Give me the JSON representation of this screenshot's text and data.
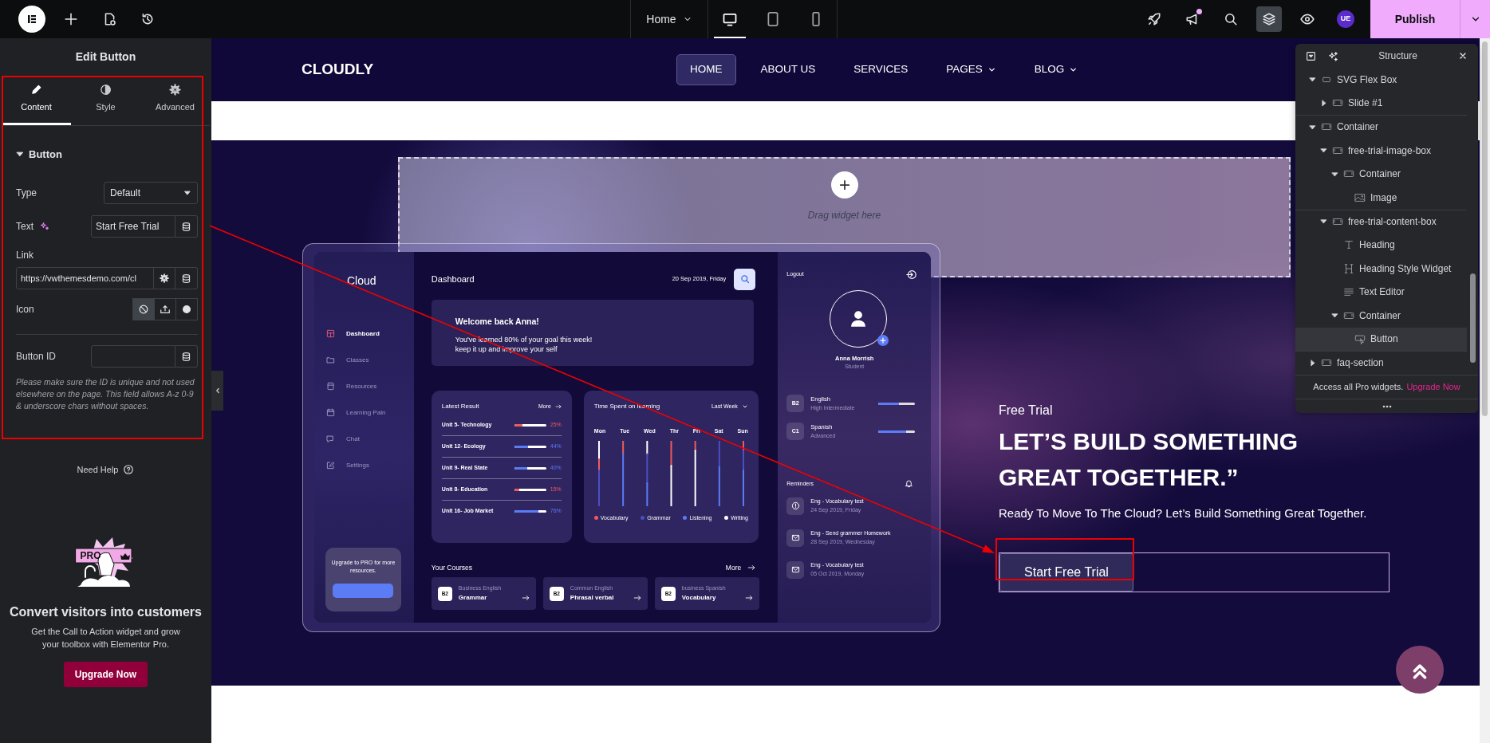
{
  "topbar": {
    "page": "Home",
    "devices": [
      {
        "kind": "desktop",
        "selected": true
      },
      {
        "kind": "tablet",
        "selected": false
      },
      {
        "kind": "mobile",
        "selected": false
      }
    ],
    "notification": true,
    "structure_open": true,
    "avatar": "UE",
    "publish": "Publish"
  },
  "editor_panel": {
    "title": "Edit Button",
    "tabs": [
      {
        "label": "Content",
        "kind": "pencil",
        "selected": true
      },
      {
        "label": "Style",
        "kind": "contrast",
        "selected": false
      },
      {
        "label": "Advanced",
        "kind": "gear",
        "selected": false
      }
    ],
    "section": {
      "title": "Button",
      "expanded": true
    },
    "fields": [
      {
        "kind": "select",
        "label": "Type",
        "value": "Default"
      },
      {
        "kind": "text",
        "label": "Text",
        "value": "Start Free Trial",
        "ai": true
      },
      {
        "kind": "link",
        "label": "Link",
        "value": "https://vwthemesdemo.com/cl"
      },
      {
        "kind": "choice",
        "label": "Icon",
        "options": [
          {
            "kind": "none",
            "selected": true
          },
          {
            "kind": "upload",
            "selected": false
          },
          {
            "kind": "svg",
            "selected": false
          }
        ]
      },
      {
        "kind": "id",
        "label": "Button ID"
      }
    ],
    "note": "Please make sure the ID is unique and not used elsewhere on the page. This field allows A-z  0-9 & underscore chars without spaces."
  },
  "help": "Need Help",
  "promo": {
    "badge": "PRO",
    "title": "Convert visitors into customers",
    "text": "Get the Call to Action widget and grow your toolbox with Elementor Pro.",
    "button": "Upgrade Now"
  },
  "site": {
    "brand": "CLOUDLY",
    "nav": [
      {
        "label": "HOME",
        "selected": true,
        "dropdown": false
      },
      {
        "label": "ABOUT US",
        "selected": false,
        "dropdown": false
      },
      {
        "label": "SERVICES",
        "selected": false,
        "dropdown": false
      },
      {
        "label": "PAGES",
        "selected": false,
        "dropdown": true
      },
      {
        "label": "BLOG",
        "selected": false,
        "dropdown": true
      }
    ],
    "dropzone": "Drag widget here",
    "dashboard": {
      "brand": "Cloud",
      "title": "Dashboard",
      "date": "20 Sep 2019, Friday",
      "menu": [
        {
          "label": "Dashboard",
          "kind": "grid",
          "selected": true
        },
        {
          "label": "Classes",
          "kind": "folder",
          "selected": false
        },
        {
          "label": "Resources",
          "kind": "box",
          "selected": false
        },
        {
          "label": "Learning Paln",
          "kind": "calendar",
          "selected": false
        },
        {
          "label": "Chat",
          "kind": "chat",
          "selected": false
        },
        {
          "label": "Settings",
          "kind": "edit",
          "selected": false
        }
      ],
      "upgrade": "Upgrade to PRO for more resources.",
      "welcome": {
        "title": "Welcome back Anna!",
        "lines": [
          "You've learned 80% of your goal this week!",
          "keep it up and improve your self"
        ]
      },
      "results": {
        "title": "Latest Result",
        "more": "More",
        "rows": [
          {
            "name": "Unit 5- Technology",
            "level": 0.25,
            "reading": "25%",
            "color": "#ef5b5b"
          },
          {
            "name": "Unit 12- Ecology",
            "level": 0.44,
            "reading": "44%",
            "color": "#5b7cf5"
          },
          {
            "name": "Unit 9- Real State",
            "level": 0.4,
            "reading": "40%",
            "color": "#5b7cf5"
          },
          {
            "name": "Unit 8- Education",
            "level": 0.15,
            "reading": "15%",
            "color": "#ef5b5b"
          },
          {
            "name": "Unit 16- Job Market",
            "level": 0.76,
            "reading": "76%",
            "color": "#5b7cf5"
          }
        ]
      },
      "time": {
        "title": "Time Spent on learning",
        "period": "Last Week",
        "days": [
          "Mon",
          "Tue",
          "Wed",
          "Thr",
          "Fri",
          "Sat",
          "Sun"
        ],
        "legend": [
          {
            "label": "Vocabulary",
            "color": "#ef5b5b"
          },
          {
            "label": "Grammar",
            "color": "#4b4fc0"
          },
          {
            "label": "Listening",
            "color": "#5b7cf5"
          },
          {
            "label": "Writing",
            "color": "#ffffff"
          }
        ]
      },
      "courses": {
        "title": "Your Courses",
        "more": "More",
        "items": [
          {
            "grade": "B2",
            "category": "Business English",
            "name": "Grammar"
          },
          {
            "grade": "B2",
            "category": "Common English",
            "name": "Phrasal verbal"
          },
          {
            "grade": "B2",
            "category": "business Spanish",
            "name": "Vocabulary"
          }
        ]
      },
      "logout": "Logout",
      "profile": {
        "name": "Anna Morrish",
        "role": "Student"
      },
      "languages": [
        {
          "grade": "B2",
          "name": "English",
          "proficiency": "High Intermediate",
          "level": 0.57
        },
        {
          "grade": "C1",
          "name": "Spanish",
          "proficiency": "Advanced",
          "level": 0.77
        }
      ],
      "reminders": {
        "title": "Reminders",
        "items": [
          {
            "kind": "alert",
            "title": "Eng - Vocabulary test",
            "date": "24 Sep 2019, Friday"
          },
          {
            "kind": "mail",
            "title": "Eng - Send grammer Homework",
            "date": "28 Sep 2019, Wednesday"
          },
          {
            "kind": "mail",
            "title": "Eng - Vocabulary test",
            "date": "05 Oct 2019, Monday"
          }
        ]
      }
    },
    "hero": {
      "eyebrow": "Free Trial",
      "heading": "LET’S BUILD SOMETHING GREAT TOGETHER.”",
      "text": "Ready To Move To The Cloud? Let’s Build Something Great Together.",
      "button": "Start Free Trial"
    }
  },
  "structure": {
    "title": "Structure",
    "tree": [
      {
        "label": "SVG Flex Box",
        "kind": "flexbox",
        "expanded": true,
        "selected": false,
        "children": [
          {
            "label": "Slide #1",
            "kind": "container",
            "expanded": false,
            "selected": false
          }
        ]
      },
      {
        "label": "Container",
        "kind": "container",
        "expanded": true,
        "selected": false,
        "children": [
          {
            "label": "free-trial-image-box",
            "kind": "container",
            "expanded": true,
            "selected": false,
            "children": [
              {
                "label": "Container",
                "kind": "container",
                "expanded": true,
                "selected": false,
                "children": [
                  {
                    "label": "Image",
                    "kind": "image",
                    "selected": false
                  }
                ]
              }
            ]
          },
          {
            "label": "free-trial-content-box",
            "kind": "container",
            "expanded": true,
            "selected": false,
            "children": [
              {
                "label": "Heading",
                "kind": "heading",
                "selected": false
              },
              {
                "label": "Heading Style Widget",
                "kind": "heading-style",
                "selected": false
              },
              {
                "label": "Text Editor",
                "kind": "text-editor",
                "selected": false
              },
              {
                "label": "Container",
                "kind": "container",
                "expanded": true,
                "selected": false,
                "children": [
                  {
                    "label": "Button",
                    "kind": "button",
                    "selected": true
                  }
                ]
              }
            ]
          }
        ]
      },
      {
        "label": "faq-section",
        "kind": "container",
        "expanded": false,
        "selected": false
      }
    ],
    "footer": "Access all Pro widgets.",
    "footer_link": "Upgrade Now"
  }
}
